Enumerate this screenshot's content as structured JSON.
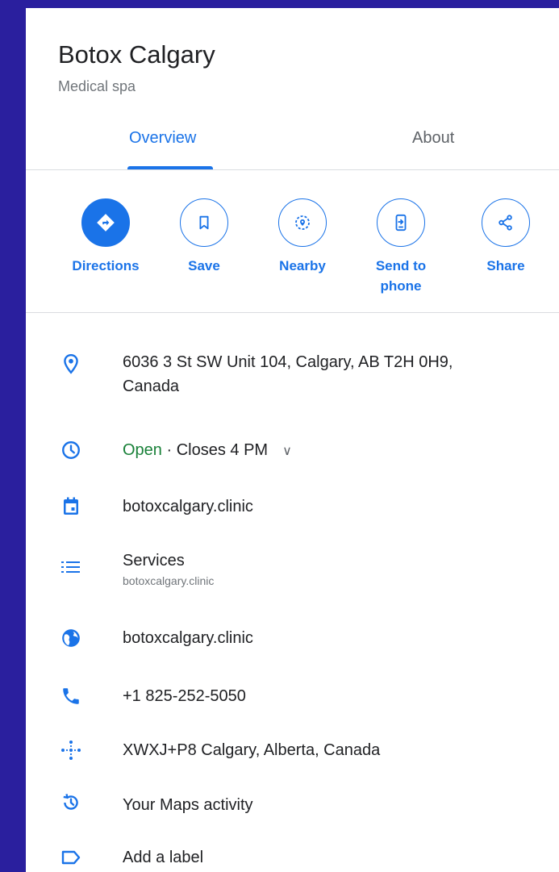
{
  "place": {
    "name": "Botox Calgary",
    "category": "Medical spa"
  },
  "tabs": [
    {
      "label": "Overview",
      "active": true
    },
    {
      "label": "About",
      "active": false
    }
  ],
  "actions": [
    {
      "label": "Directions",
      "icon": "directions-icon"
    },
    {
      "label": "Save",
      "icon": "bookmark-icon"
    },
    {
      "label": "Nearby",
      "icon": "nearby-icon"
    },
    {
      "label_line1": "Send to",
      "label_line2": "phone",
      "icon": "send-to-phone-icon"
    },
    {
      "label": "Share",
      "icon": "share-icon"
    }
  ],
  "details": {
    "address_line1": "6036 3 St SW Unit 104, Calgary, AB T2H 0H9,",
    "address_line2": "Canada",
    "hours_status": "Open",
    "hours_rest": " · Closes 4 PM",
    "appointment": "botoxcalgary.clinic",
    "services_label": "Services",
    "services_url": "botoxcalgary.clinic",
    "website": "botoxcalgary.clinic",
    "phone": "+1 825-252-5050",
    "plus_code": "XWXJ+P8 Calgary, Alberta, Canada",
    "maps_activity": "Your Maps activity",
    "add_label": "Add a label"
  },
  "colors": {
    "accent": "#1a73e8",
    "open_green": "#188038",
    "background": "#2a1f9e"
  }
}
